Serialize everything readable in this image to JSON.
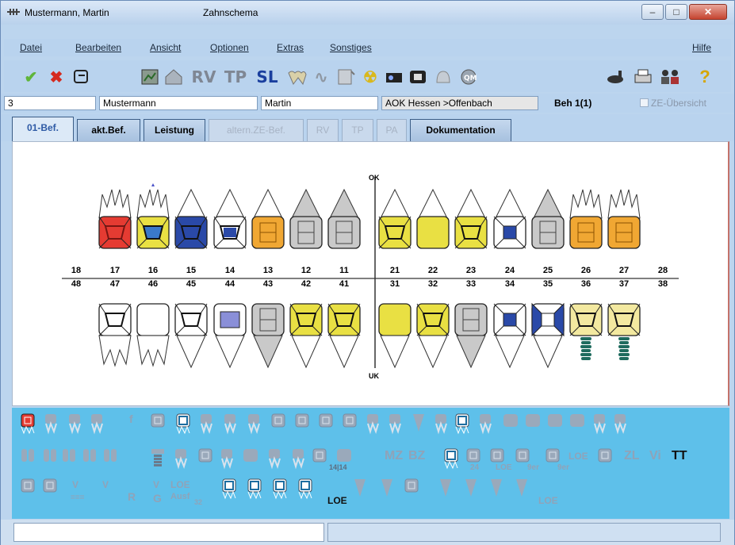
{
  "window": {
    "patient_title": "Mustermann, Martin",
    "app_title": "Zahnschema",
    "controls": {
      "minimize": "–",
      "maximize": "□",
      "close": "✕"
    }
  },
  "menu": {
    "items": [
      "Datei",
      "Bearbeiten",
      "Ansicht",
      "Optionen",
      "Extras",
      "Sonstiges"
    ],
    "help": "Hilfe"
  },
  "toolbar": {
    "text_buttons": [
      "RV",
      "TP",
      "SL"
    ],
    "icons": [
      "check-icon",
      "cancel-icon",
      "refresh-icon",
      "chart-icon",
      "house-icon",
      "rv-icon",
      "tp-icon",
      "sl-icon",
      "teeth-icon",
      "wave-icon",
      "note-icon",
      "radiation-icon",
      "camera-icon",
      "film-icon",
      "bell-icon",
      "qm-icon",
      "scanner-icon",
      "printer-icon",
      "patients-icon",
      "help-icon"
    ]
  },
  "patient": {
    "number": "3",
    "last_name": "Mustermann",
    "first_name": "Martin",
    "insurance": "AOK Hessen >Offenbach",
    "treatment": "Beh 1(1)",
    "ze_overview": "ZE-Übersicht"
  },
  "tabs": [
    {
      "label": "01-Bef.",
      "state": "active"
    },
    {
      "label": "akt.Bef.",
      "state": "normal"
    },
    {
      "label": "Leistung",
      "state": "normal"
    },
    {
      "label": "altern.ZE-Bef.",
      "state": "disabled"
    },
    {
      "label": "RV",
      "state": "disabled"
    },
    {
      "label": "TP",
      "state": "disabled"
    },
    {
      "label": "PA",
      "state": "disabled"
    },
    {
      "label": "Dokumentation",
      "state": "normal"
    }
  ],
  "chart": {
    "upper_label": "OK",
    "lower_label": "UK",
    "upper_numbers": [
      "18",
      "17",
      "16",
      "15",
      "14",
      "13",
      "12",
      "11",
      "21",
      "22",
      "23",
      "24",
      "25",
      "26",
      "27",
      "28"
    ],
    "lower_numbers": [
      "48",
      "47",
      "46",
      "45",
      "44",
      "43",
      "42",
      "41",
      "31",
      "32",
      "33",
      "34",
      "35",
      "36",
      "37",
      "38"
    ],
    "upper_teeth": [
      {
        "tooth": "18",
        "state": "none"
      },
      {
        "tooth": "17",
        "state": "red",
        "color": "#e53b32"
      },
      {
        "tooth": "16",
        "state": "yellow-blue",
        "color": "#e5d930"
      },
      {
        "tooth": "15",
        "state": "blue",
        "color": "#2a49a8"
      },
      {
        "tooth": "14",
        "state": "blue-white",
        "color": "#2a49a8"
      },
      {
        "tooth": "13",
        "state": "orange",
        "color": "#f0a733"
      },
      {
        "tooth": "12",
        "state": "grey",
        "color": "#c9c9c9"
      },
      {
        "tooth": "11",
        "state": "grey",
        "color": "#c9c9c9"
      },
      {
        "tooth": "21",
        "state": "yellow",
        "color": "#e9e043"
      },
      {
        "tooth": "22",
        "state": "yellow-plain",
        "color": "#e9e043"
      },
      {
        "tooth": "23",
        "state": "yellow",
        "color": "#e9e043"
      },
      {
        "tooth": "24",
        "state": "blue-small",
        "color": "#2a49a8"
      },
      {
        "tooth": "25",
        "state": "grey",
        "color": "#c9c9c9"
      },
      {
        "tooth": "26",
        "state": "orange",
        "color": "#f0a733"
      },
      {
        "tooth": "27",
        "state": "orange",
        "color": "#f0a733"
      },
      {
        "tooth": "28",
        "state": "none"
      }
    ],
    "lower_teeth": [
      {
        "tooth": "48",
        "state": "none"
      },
      {
        "tooth": "47",
        "state": "white"
      },
      {
        "tooth": "46",
        "state": "white-plain"
      },
      {
        "tooth": "45",
        "state": "white"
      },
      {
        "tooth": "44",
        "state": "dotted-blue",
        "color": "#8a8fd8"
      },
      {
        "tooth": "43",
        "state": "grey",
        "color": "#c9c9c9"
      },
      {
        "tooth": "42",
        "state": "yellow",
        "color": "#e9e043"
      },
      {
        "tooth": "41",
        "state": "yellow",
        "color": "#e9e043"
      },
      {
        "tooth": "31",
        "state": "yellow-plain",
        "color": "#e9e043"
      },
      {
        "tooth": "32",
        "state": "yellow",
        "color": "#e9e043"
      },
      {
        "tooth": "33",
        "state": "grey",
        "color": "#c9c9c9"
      },
      {
        "tooth": "34",
        "state": "blue-small",
        "color": "#2a49a8"
      },
      {
        "tooth": "35",
        "state": "blue-wide",
        "color": "#2a49a8"
      },
      {
        "tooth": "36",
        "state": "implant",
        "color": "#f3e9a0"
      },
      {
        "tooth": "37",
        "state": "implant",
        "color": "#f3e9a0"
      },
      {
        "tooth": "38",
        "state": "none"
      }
    ]
  },
  "palette": {
    "row1_symbols": [
      "f"
    ],
    "row2_labels": [
      "MZ",
      "BZ",
      "LOE",
      "ZL",
      "Vi",
      "TT"
    ],
    "row2_sub": [
      "14|14",
      "24",
      "LOE",
      "9er",
      "9er"
    ],
    "row3_labels": [
      "V",
      "V",
      "R",
      "V",
      "G",
      "LOE",
      "Ausf",
      "LOE",
      "LOE"
    ],
    "row3_sub": [
      "===",
      "32"
    ]
  },
  "status": {
    "message": ""
  }
}
